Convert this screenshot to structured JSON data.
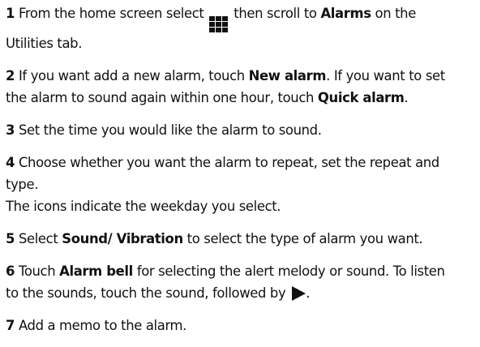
{
  "steps": [
    {
      "num": "1",
      "line1_pre": "From the home screen select",
      "icon": "grid-menu-icon",
      "line1_mid": "then scroll to",
      "line1_bold": "Alarms",
      "line1_post": "on the",
      "line2": "Utilities tab."
    },
    {
      "num": "2",
      "line1_pre": "If you want add a new alarm, touch",
      "line1_bold": "New alarm",
      "line1_post": ". If you want to set",
      "line2_pre": "the alarm to sound again within one hour, touch",
      "line2_bold": "Quick alarm",
      "line2_post": "."
    },
    {
      "num": "3",
      "text": "Set the time you would like the alarm to sound."
    },
    {
      "num": "4",
      "line1": "Choose whether you want the alarm to repeat, set the repeat and",
      "line2": "type.",
      "line3": "The icons indicate the weekday you select."
    },
    {
      "num": "5",
      "pre": "Select",
      "bold": "Sound/ Vibration",
      "post": "to select the type of alarm you want."
    },
    {
      "num": "6",
      "line1_pre": "Touch",
      "line1_bold": "Alarm bell",
      "line1_post": "for selecting the alert melody or sound. To listen",
      "line2": "to the sounds, touch the sound, followed by",
      "icon": "play-icon",
      "line2_post": "."
    },
    {
      "num": "7",
      "text": "Add a memo to the alarm."
    }
  ]
}
